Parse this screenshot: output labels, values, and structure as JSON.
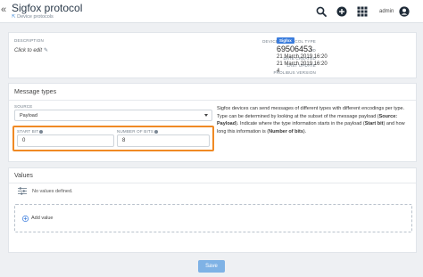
{
  "header": {
    "back_icon": "«",
    "title": "Sigfox protocol",
    "breadcrumb": "Device protocols",
    "user": "admin",
    "icons": [
      "search-icon",
      "plus-circle-icon",
      "apps-grid-icon",
      "user-avatar-icon"
    ],
    "accent": "#1f2b38"
  },
  "info": {
    "description_label": "DESCRIPTION",
    "description_value": "Click to edit",
    "edit_icon": "✎",
    "device_protocol_type_label": "DEVICE PROTOCOL TYPE",
    "device_protocol_type_value": "Sigfox",
    "id_label": "ID",
    "id_value": "69506453",
    "date_created_label": "DATE CREATED",
    "date_created_value": "21 March 2019 16:20",
    "last_update_label": "LAST UPDATE",
    "last_update_value": "21 March 2019 16:20",
    "version_label": "PROLIBUS VERSION",
    "version_value": "4"
  },
  "message_types": {
    "title": "Message types",
    "source_label": "SOURCE",
    "source_value": "Payload",
    "start_bit_label": "START BIT",
    "start_bit_value": "0",
    "number_of_bits_label": "NUMBER OF BITS",
    "number_of_bits_value": "8",
    "help_text": "Sigfox devices can send messages of different types with different encodings per type. Type can be determined by looking at the subset of the message payload (Source: Payload). Indicate where the type information starts in the payload (Start bit) and how long this information is (Number of bits).",
    "highlight_color": "#f08a24"
  },
  "values": {
    "title": "Values",
    "empty_text": "No values defined.",
    "add_label": "Add value"
  },
  "footer": {
    "save_label": "Save",
    "save_color": "#7fb2e5"
  }
}
